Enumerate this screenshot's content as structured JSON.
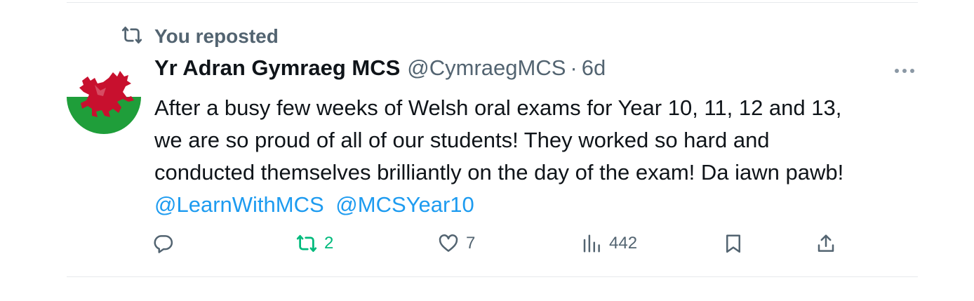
{
  "repost_banner": {
    "label": "You reposted",
    "icon": "repost-icon"
  },
  "author": {
    "display_name": "Yr Adran Gymraeg MCS",
    "handle": "@CymraegMCS",
    "separator": "·",
    "time": "6d",
    "avatar": "welsh-flag-dragon"
  },
  "tweet": {
    "lines": [
      "After a busy few weeks of Welsh oral exams for Year 10, 11, 12 and 13,",
      "we are so proud of all of our students! They worked so hard and",
      "conducted themselves brilliantly on the day of the exam! Da iawn pawb!"
    ],
    "mentions": [
      "@LearnWithMCS",
      "@MCSYear10"
    ]
  },
  "actions": {
    "reply": {
      "icon": "reply-icon",
      "count": ""
    },
    "repost": {
      "icon": "repost-icon",
      "count": "2",
      "active": true
    },
    "like": {
      "icon": "heart-icon",
      "count": "7"
    },
    "views": {
      "icon": "views-icon",
      "count": "442"
    },
    "bookmark": {
      "icon": "bookmark-icon"
    },
    "share": {
      "icon": "share-icon"
    }
  },
  "colors": {
    "text": "#0f1419",
    "secondary": "#536471",
    "link": "#1d9bf0",
    "repost_active": "#00ba7c",
    "divider": "#e6e9ec",
    "flag_green": "#1f9e3a",
    "flag_red": "#c8102e"
  }
}
